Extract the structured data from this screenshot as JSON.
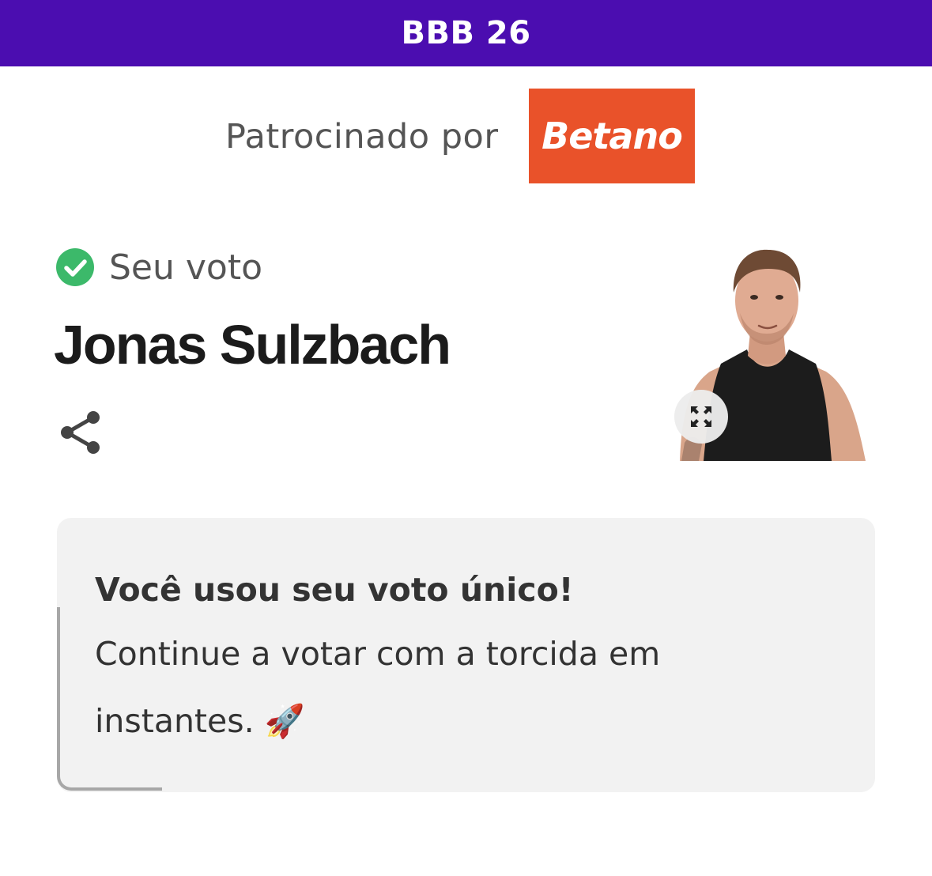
{
  "header": {
    "title": "BBB 26",
    "background_color": "#4b0db0"
  },
  "sponsor": {
    "label": "Patrocinado por",
    "logo_text": "Betano",
    "logo_color": "#e9522a"
  },
  "vote": {
    "status_icon": "check-circle-icon",
    "status_color": "#3cb96a",
    "status_label": "Seu voto",
    "candidate_name": "Jonas Sulzbach",
    "share_icon": "share-icon",
    "expand_icon": "expand-icon"
  },
  "info_card": {
    "title": "Você usou seu voto único!",
    "message": "Continue a votar com a torcida em instantes. 🚀"
  }
}
